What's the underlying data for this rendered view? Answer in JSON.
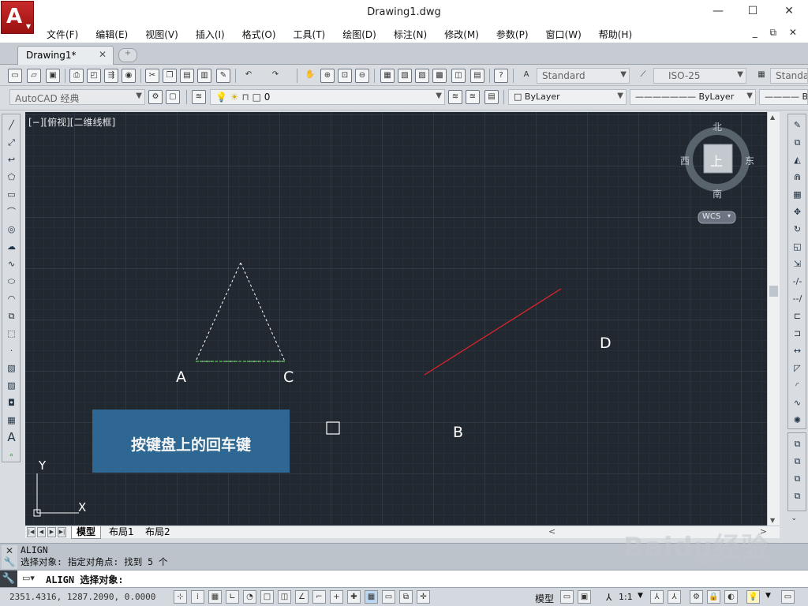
{
  "window": {
    "title": "Drawing1.dwg",
    "controls": [
      "—",
      "☐",
      "✕"
    ]
  },
  "menu": {
    "items": [
      "文件(F)",
      "编辑(E)",
      "视图(V)",
      "插入(I)",
      "格式(O)",
      "工具(T)",
      "绘图(D)",
      "标注(N)",
      "修改(M)",
      "参数(P)",
      "窗口(W)",
      "帮助(H)"
    ]
  },
  "tabs": {
    "active": "Drawing1*",
    "close": "✕"
  },
  "toolbar": {
    "text_style": "Standard",
    "dim_style": "ISO-25",
    "table_style": "Standa",
    "workspace": "AutoCAD 经典",
    "layer": "0",
    "color": "ByLayer",
    "linetype": "ByLayer",
    "lineweight": "By"
  },
  "viewport": {
    "label": "[−][俯视][二维线框]"
  },
  "viewcube": {
    "north": "北",
    "south": "南",
    "east": "东",
    "west": "西",
    "face": "上",
    "wcs": "WCS"
  },
  "points": {
    "a": "A",
    "b": "B",
    "c": "C",
    "d": "D"
  },
  "ucs": {
    "x": "X",
    "y": "Y"
  },
  "banner": {
    "text": "按键盘上的回车键"
  },
  "layout_tabs": [
    "模型",
    "布局1",
    "布局2"
  ],
  "command": {
    "history": [
      "ALIGN",
      "选择对象: 指定对角点: 找到 5 个"
    ],
    "prompt": "ALIGN 选择对象:"
  },
  "status": {
    "coords": "2351.4316, 1287.2090, 0.0000",
    "model": "模型",
    "scale": "1:1"
  },
  "watermark": {
    "brand": "Baidu经验",
    "url": "jingyan.baidu.com"
  },
  "colors": {
    "canvas": "#212830",
    "line_red": "#e0242c",
    "line_green": "#4fd24a",
    "banner": "#2e6a96"
  }
}
